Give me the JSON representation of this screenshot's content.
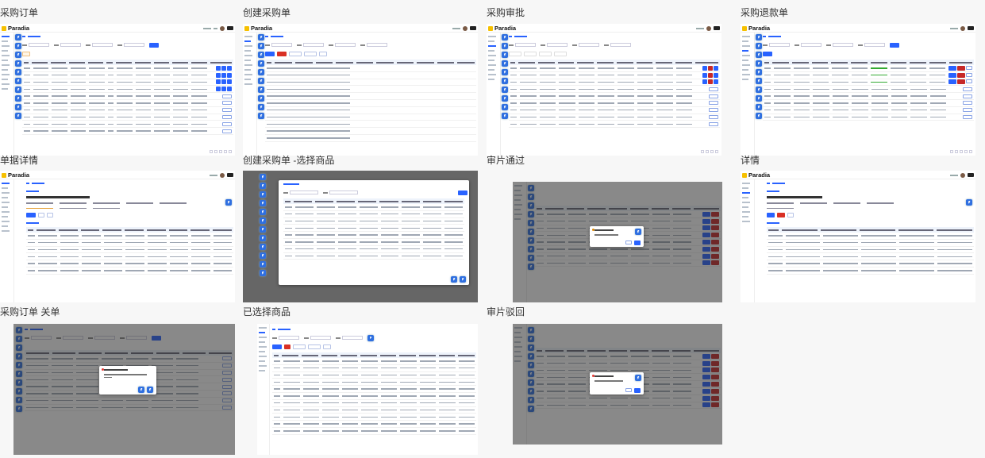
{
  "app": {
    "logo_text": "Paradia"
  },
  "cards": [
    {
      "id": "purchase-order",
      "title": "采购订单"
    },
    {
      "id": "create-purchase-order",
      "title": "创建采购单"
    },
    {
      "id": "purchase-approval",
      "title": "采购审批"
    },
    {
      "id": "purchase-refund",
      "title": "采购退款单"
    },
    {
      "id": "order-detail",
      "title": "单据详情"
    },
    {
      "id": "create-select-product",
      "title": "创建采购单 -选择商品"
    },
    {
      "id": "approve-pass",
      "title": "审片通过"
    },
    {
      "id": "detail",
      "title": "详情"
    },
    {
      "id": "purchase-order-close",
      "title": "采购订单 关单"
    },
    {
      "id": "selected-products",
      "title": "已选择商品"
    },
    {
      "id": "approve-reject",
      "title": "审片驳回"
    }
  ],
  "colors": {
    "primary": "#2962ff",
    "danger": "#d93025",
    "logo_mark": "#f6c000"
  }
}
